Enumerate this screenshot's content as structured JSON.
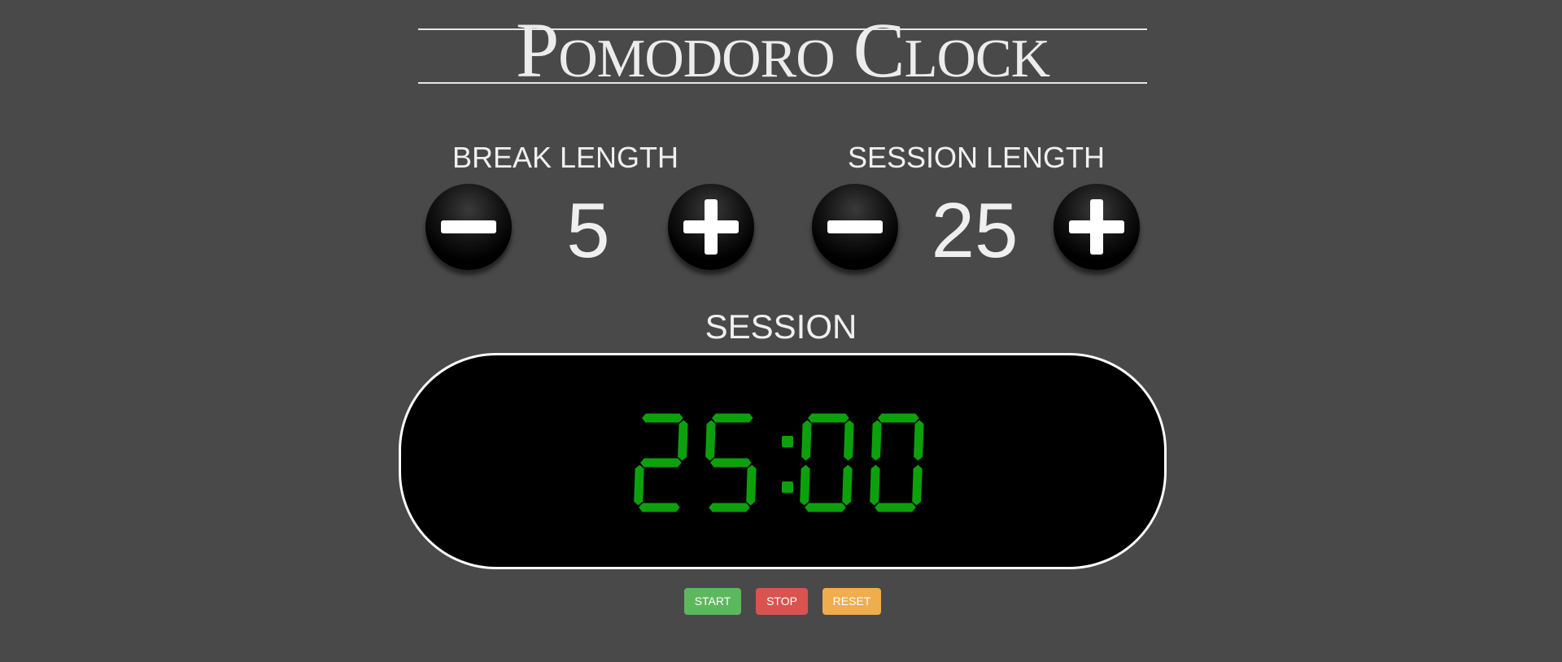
{
  "title": "Pomodoro Clock",
  "break_control": {
    "label": "BREAK LENGTH",
    "value": "5",
    "decrement_icon": "minus-icon",
    "increment_icon": "plus-icon"
  },
  "session_control": {
    "label": "SESSION LENGTH",
    "value": "25",
    "decrement_icon": "minus-icon",
    "increment_icon": "plus-icon"
  },
  "timer": {
    "mode_label": "SESSION",
    "time": "25:00",
    "digit_color": "#0ca10c"
  },
  "actions": {
    "start_label": "START",
    "stop_label": "STOP",
    "reset_label": "RESET",
    "start_color": "#5cb85c",
    "stop_color": "#d9534f",
    "reset_color": "#f0ad4e"
  },
  "colors": {
    "background": "#494949",
    "display_background": "#000000",
    "text": "#eeeeee"
  }
}
